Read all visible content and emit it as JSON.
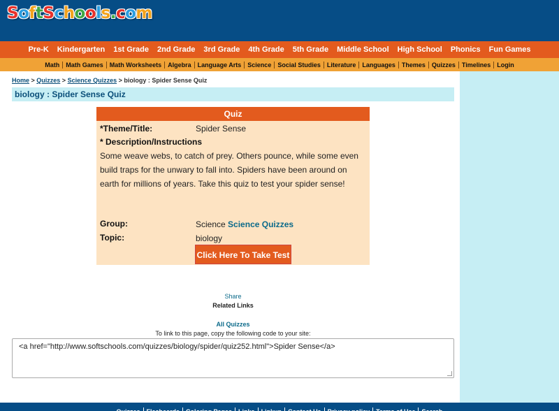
{
  "logo": {
    "letters": [
      {
        "ch": "S",
        "color": "#e8312a"
      },
      {
        "ch": "o",
        "color": "#2a9de0"
      },
      {
        "ch": "f",
        "color": "#f2a21b"
      },
      {
        "ch": "t",
        "color": "#41a845"
      },
      {
        "ch": "S",
        "color": "#e8312a"
      },
      {
        "ch": "c",
        "color": "#2a9de0"
      },
      {
        "ch": "h",
        "color": "#f2a21b"
      },
      {
        "ch": "o",
        "color": "#41a845"
      },
      {
        "ch": "o",
        "color": "#e8312a"
      },
      {
        "ch": "l",
        "color": "#2a9de0"
      },
      {
        "ch": "s",
        "color": "#f2a21b"
      },
      {
        "ch": ".",
        "color": "#41a845"
      },
      {
        "ch": "c",
        "color": "#e8312a"
      },
      {
        "ch": "o",
        "color": "#2a9de0"
      },
      {
        "ch": "m",
        "color": "#f2a21b"
      }
    ]
  },
  "nav_primary": [
    "Pre-K",
    "Kindergarten",
    "1st Grade",
    "2nd Grade",
    "3rd Grade",
    "4th Grade",
    "5th Grade",
    "Middle School",
    "High School",
    "Phonics",
    "Fun Games"
  ],
  "nav_secondary": [
    "Math",
    "Math Games",
    "Math Worksheets",
    "Algebra",
    "Language Arts",
    "Science",
    "Social Studies",
    "Literature",
    "Languages",
    "Themes",
    "Quizzes",
    "Timelines",
    "Login"
  ],
  "breadcrumb": {
    "home": "Home",
    "sep1": " > ",
    "quizzes": "Quizzes",
    "sep2": " > ",
    "science": "Science Quizzes",
    "sep3": " > ",
    "current": "biology : Spider Sense Quiz"
  },
  "page_title": "biology : Spider Sense Quiz",
  "quiz": {
    "header": "Quiz",
    "theme_label": "*Theme/Title:",
    "theme_value": "Spider Sense",
    "desc_label": "* Description/Instructions",
    "description": "Some weave webs, to catch of prey. Others pounce, while some even build traps for the unwary to fall into. Spiders have been around on earth for millions of years. Take this quiz to test your spider sense!",
    "group_label": "Group:",
    "group_value": "Science",
    "group_link": "Science Quizzes",
    "topic_label": "Topic:",
    "topic_value": "biology",
    "take_test": "Click Here To Take Test"
  },
  "share": "Share",
  "related_links": "Related Links",
  "all_quizzes": "All Quizzes",
  "link_instructions": "To link to this page, copy the following code to your site:",
  "embed_code": "<a href=\"http://www.softschools.com/quizzes/biology/spider/quiz252.html\">Spider Sense</a>",
  "footer": [
    "Quizzes",
    "Flashcards",
    "Coloring Pages",
    "Links",
    "Linkup",
    "Contact Us",
    "Privacy policy",
    "Terms of Use",
    "Search"
  ],
  "colors": {
    "header": "#064d86",
    "nav_primary": "#e35b1e",
    "nav_secondary": "#f0a236",
    "sidebar": "#c6eef4",
    "quiz_bg": "#fde3c2"
  }
}
